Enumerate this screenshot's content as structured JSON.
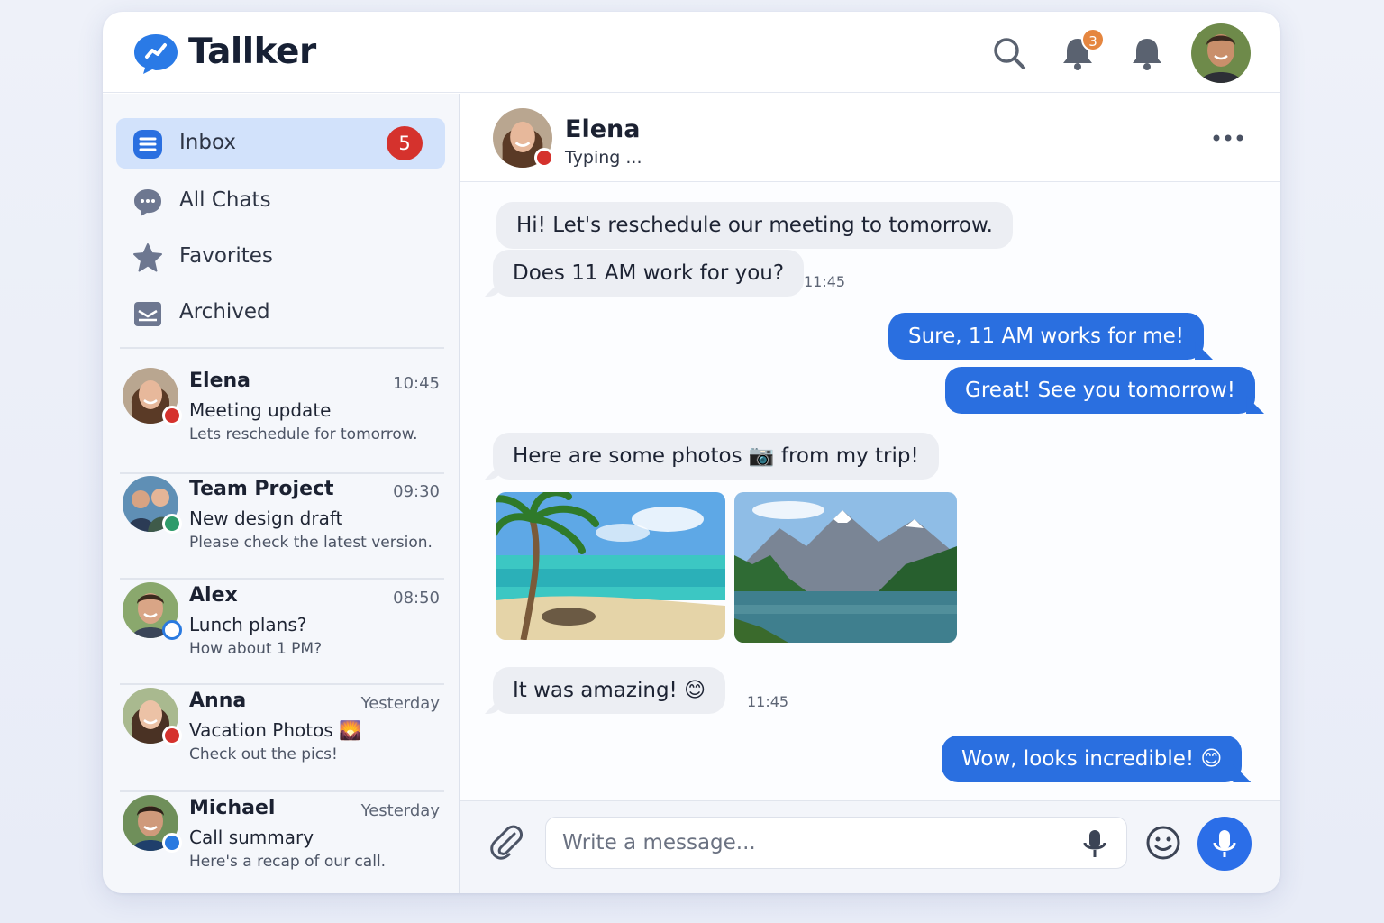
{
  "app": {
    "name": "Tallker",
    "notification_count": "3"
  },
  "sidebar": {
    "nav": [
      {
        "label": "Inbox",
        "count": "5",
        "icon": "inbox-icon"
      },
      {
        "label": "All Chats",
        "icon": "chat-bubble-icon"
      },
      {
        "label": "Favorites",
        "icon": "star-icon"
      },
      {
        "label": "Archived",
        "icon": "archive-icon"
      }
    ],
    "conversations": [
      {
        "name": "Elena",
        "time": "10:45",
        "subject": "Meeting update",
        "preview": "Lets reschedule for tomorrow.",
        "status": "busy"
      },
      {
        "name": "Team Project",
        "time": "09:30",
        "subject": "New design draft",
        "preview": "Please check the latest version.",
        "status": "online"
      },
      {
        "name": "Alex",
        "time": "08:50",
        "subject": "Lunch plans?",
        "preview": "How about 1 PM?",
        "status": "away"
      },
      {
        "name": "Anna",
        "time": "Yesterday",
        "subject": "Vacation Photos 🌄",
        "preview": "Check out the pics!",
        "status": "busy"
      },
      {
        "name": "Michael",
        "time": "Yesterday",
        "subject": "Call summary",
        "preview": "Here's a recap of our call.",
        "status": "away"
      }
    ]
  },
  "chat": {
    "name": "Elena",
    "status": "Typing ...",
    "messages": [
      {
        "from": "them",
        "text": "Hi! Let's reschedule our meeting to tomorrow."
      },
      {
        "from": "them",
        "text": "Does 11 AM work for you?",
        "time": "11:45"
      },
      {
        "from": "me",
        "text": "Sure, 11 AM works for me!"
      },
      {
        "from": "me",
        "text": "Great! See you tomorrow!"
      },
      {
        "from": "them",
        "text": "Here are some photos 📷 from my trip!"
      },
      {
        "from": "them",
        "photos": [
          "beach-photo",
          "mountain-lake-photo"
        ]
      },
      {
        "from": "them",
        "text": "It was amazing! 😊",
        "time": "11:45"
      },
      {
        "from": "me",
        "text": "Wow, looks incredible! 😊"
      }
    ]
  },
  "composer": {
    "placeholder": "Write a message..."
  },
  "colors": {
    "accent": "#2a6fe0",
    "badge": "#d5322d",
    "notification_badge": "#e5863f",
    "busy": "#d5322d",
    "online": "#2e9b6a",
    "away": "#2a7ae0"
  }
}
